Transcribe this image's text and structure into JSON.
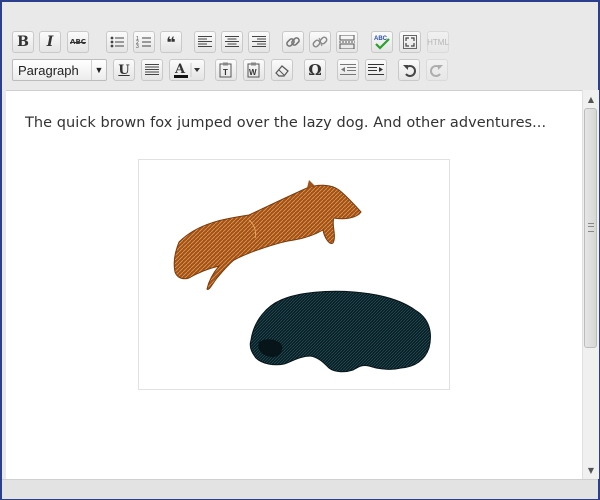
{
  "toolbar": {
    "format_select": {
      "value": "Paragraph"
    },
    "row1": [
      {
        "id": "bold",
        "glyph": "B"
      },
      {
        "id": "italic",
        "glyph": "I"
      },
      {
        "id": "strikethrough",
        "glyph": "ABC"
      },
      {
        "id": "bullet-list",
        "glyph": ""
      },
      {
        "id": "numbered-list",
        "glyph": ""
      },
      {
        "id": "blockquote",
        "glyph": "❝"
      },
      {
        "id": "align-left",
        "glyph": ""
      },
      {
        "id": "align-center",
        "glyph": ""
      },
      {
        "id": "align-right",
        "glyph": ""
      },
      {
        "id": "insert-link",
        "glyph": ""
      },
      {
        "id": "unlink",
        "glyph": ""
      },
      {
        "id": "insert-more",
        "glyph": ""
      },
      {
        "id": "spellcheck",
        "glyph": "ABC"
      },
      {
        "id": "fullscreen",
        "glyph": ""
      },
      {
        "id": "html",
        "glyph": "HTML"
      }
    ],
    "row2_glyphs": {
      "underline": "U",
      "omega": "Ω"
    }
  },
  "content": {
    "paragraph": "The quick brown fox jumped over the lazy dog.  And other adventures..."
  },
  "colors": {
    "fox": "#b8651a",
    "dog": "#102c34",
    "frame_border": "#2b3f8c"
  }
}
